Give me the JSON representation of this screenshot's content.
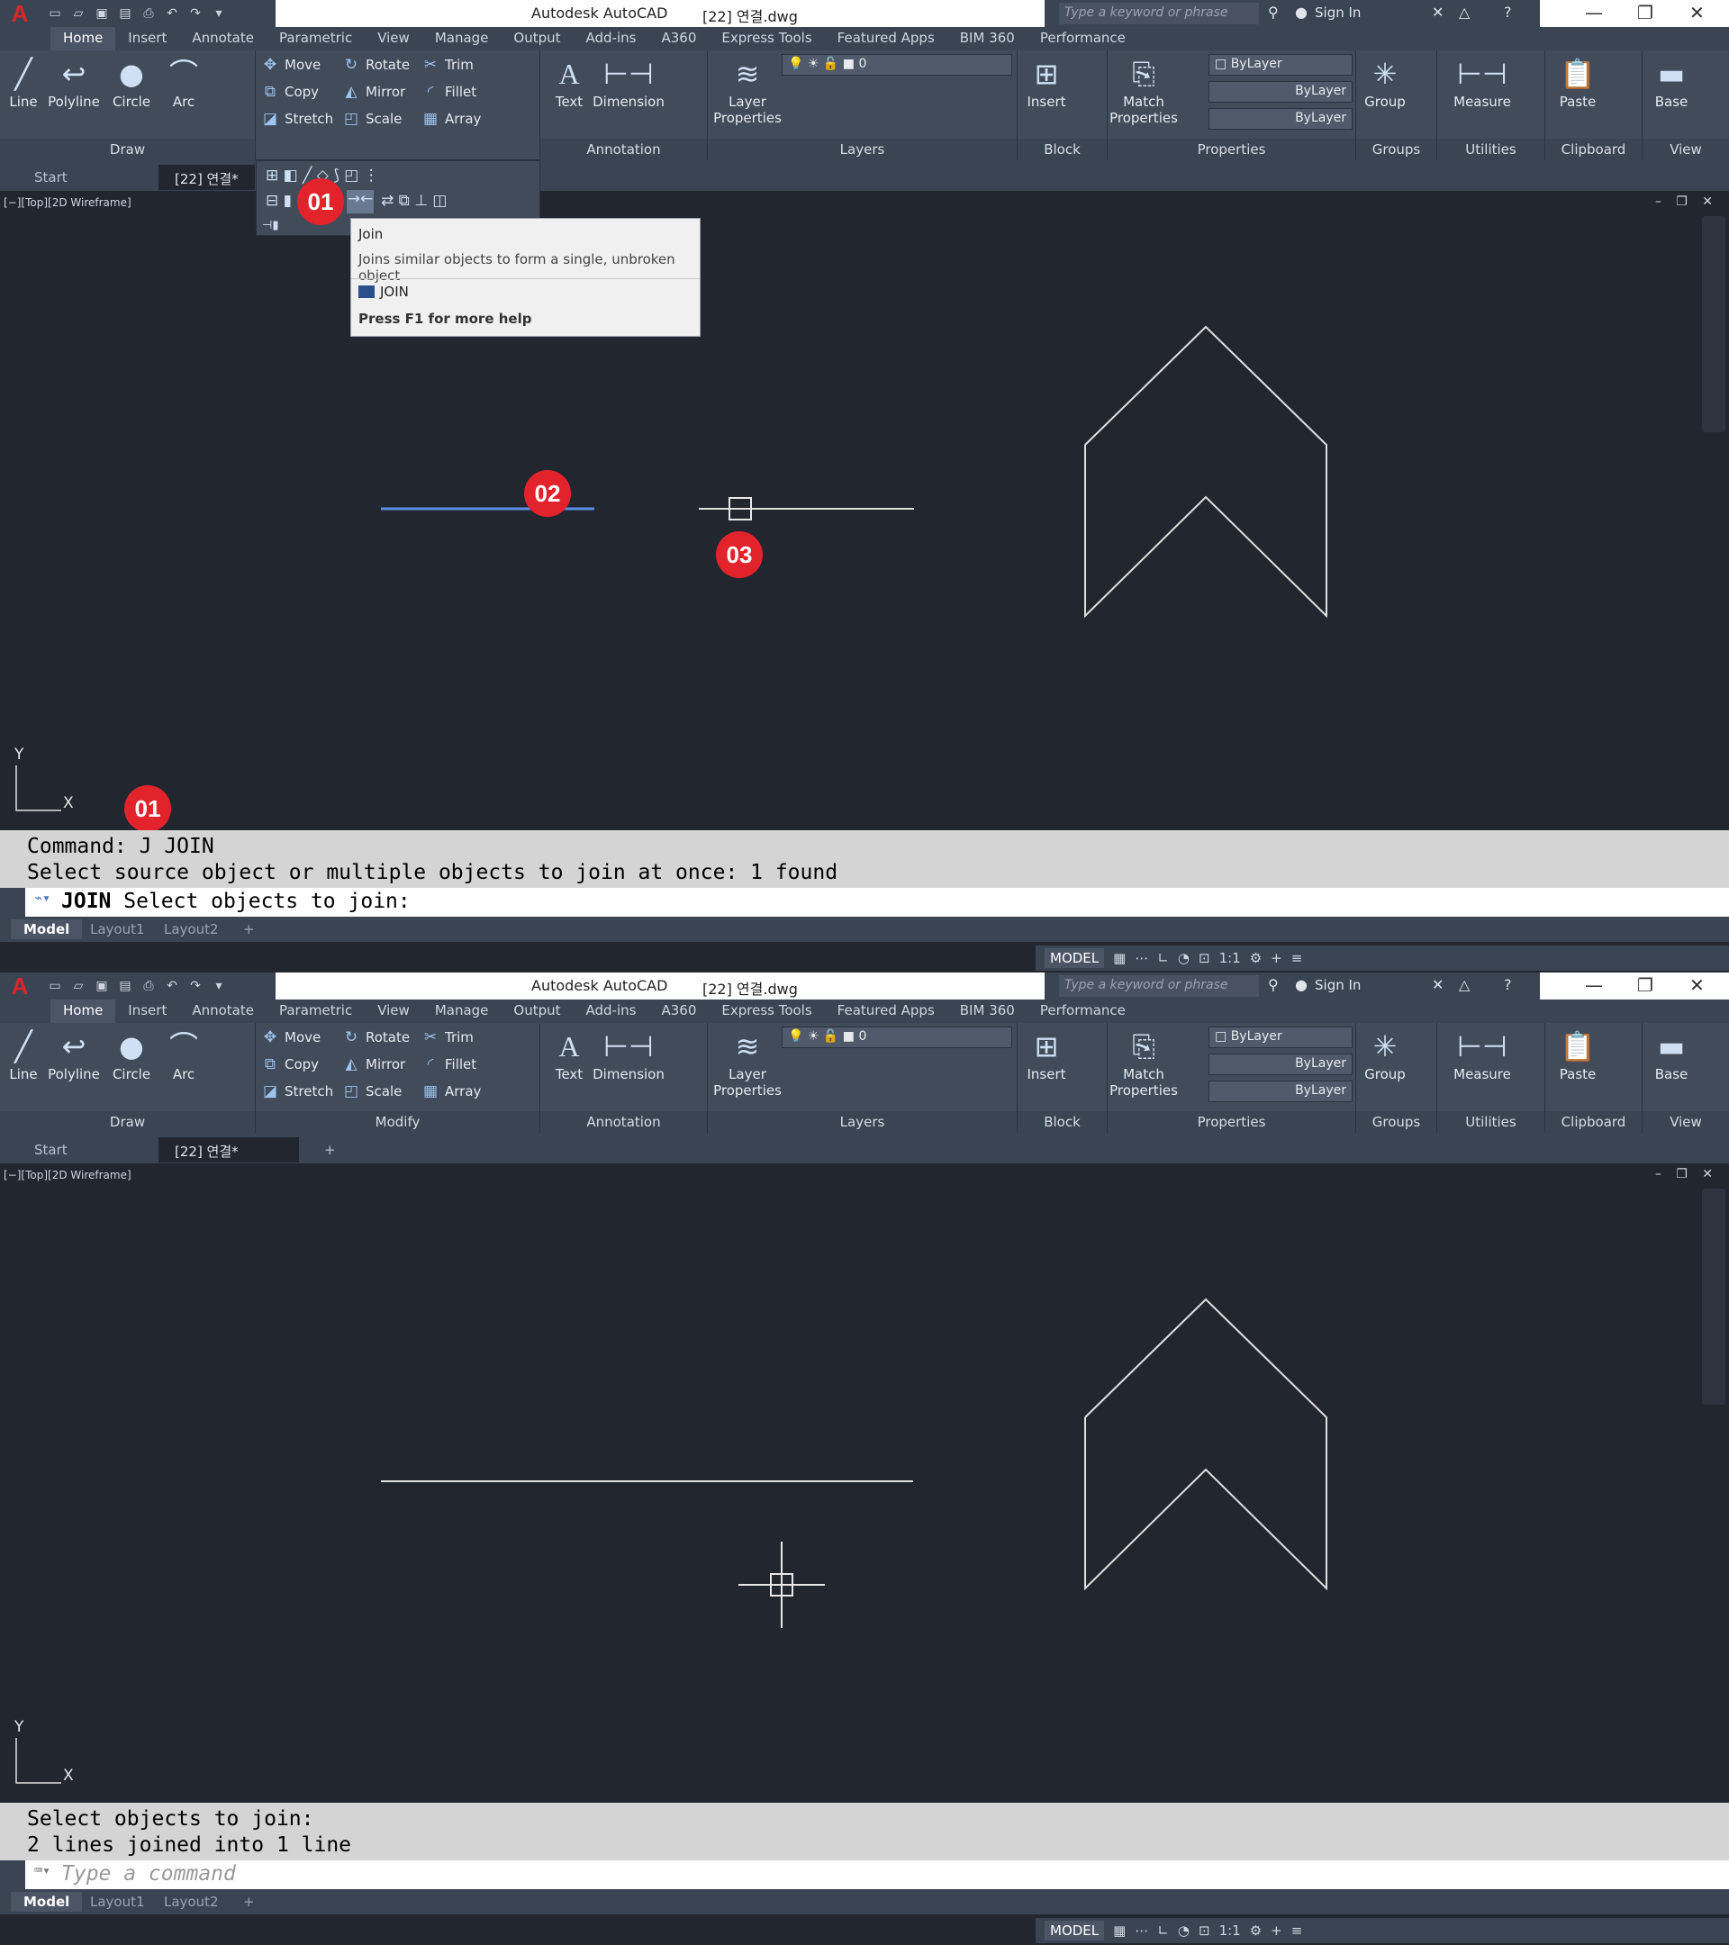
{
  "app": {
    "title": "Autodesk AutoCAD",
    "document": "[22] 연결.dwg"
  },
  "search": {
    "placeholder": "Type a keyword or phrase",
    "signin": "Sign In"
  },
  "ribbon_tabs": [
    "Home",
    "Insert",
    "Annotate",
    "Parametric",
    "View",
    "Manage",
    "Output",
    "Add-ins",
    "A360",
    "Express Tools",
    "Featured Apps",
    "BIM 360",
    "Performance"
  ],
  "draw": {
    "line": "Line",
    "polyline": "Polyline",
    "circle": "Circle",
    "arc": "Arc",
    "label": "Draw"
  },
  "modify": {
    "move": "Move",
    "rotate": "Rotate",
    "trim": "Trim",
    "copy": "Copy",
    "mirror": "Mirror",
    "fillet": "Fillet",
    "stretch": "Stretch",
    "scale": "Scale",
    "array": "Array",
    "label": "Modify"
  },
  "annotation": {
    "text": "Text",
    "dimension": "Dimension",
    "label": "Annotation"
  },
  "layers": {
    "props_line1": "Layer",
    "props_line2": "Properties",
    "current": "0",
    "label": "Layers"
  },
  "block": {
    "insert": "Insert",
    "label": "Block"
  },
  "properties": {
    "match_line1": "Match",
    "match_line2": "Properties",
    "color": "ByLayer",
    "linetype": "ByLayer",
    "lineweight": "ByLayer",
    "label": "Properties"
  },
  "groups": {
    "group": "Group",
    "label": "Groups"
  },
  "utilities": {
    "measure": "Measure",
    "label": "Utilities"
  },
  "clipboard": {
    "paste": "Paste",
    "label": "Clipboard"
  },
  "view": {
    "base": "Base",
    "label": "View"
  },
  "doctabs": {
    "start": "Start",
    "current": "[22] 연결*"
  },
  "viewport": {
    "label": "[−][Top][2D Wireframe]",
    "ucs_x": "X",
    "ucs_y": "Y"
  },
  "tooltip": {
    "title": "Join",
    "description": "Joins similar objects to form a single, unbroken object",
    "command": "JOIN",
    "help": "Press F1 for more help"
  },
  "badges": {
    "b1": "01",
    "b2": "02",
    "b3": "03",
    "b4": "01"
  },
  "shot1": {
    "history1": "Command: J JOIN",
    "history2": "Select source object or multiple objects to join at once: 1 found",
    "prompt_cmd": "JOIN",
    "prompt_text": "Select objects to join:"
  },
  "shot2": {
    "history1": "Select objects to join:",
    "history2": "2 lines joined into 1 line",
    "placeholder": "Type a command"
  },
  "layout_tabs": [
    "Model",
    "Layout1",
    "Layout2"
  ],
  "status": {
    "model": "MODEL",
    "scale": "1:1"
  },
  "colors": {
    "background": "#21262f",
    "ribbon": "#414b5a",
    "badge": "#e3232c",
    "selected_line": "#5b8ee6"
  }
}
